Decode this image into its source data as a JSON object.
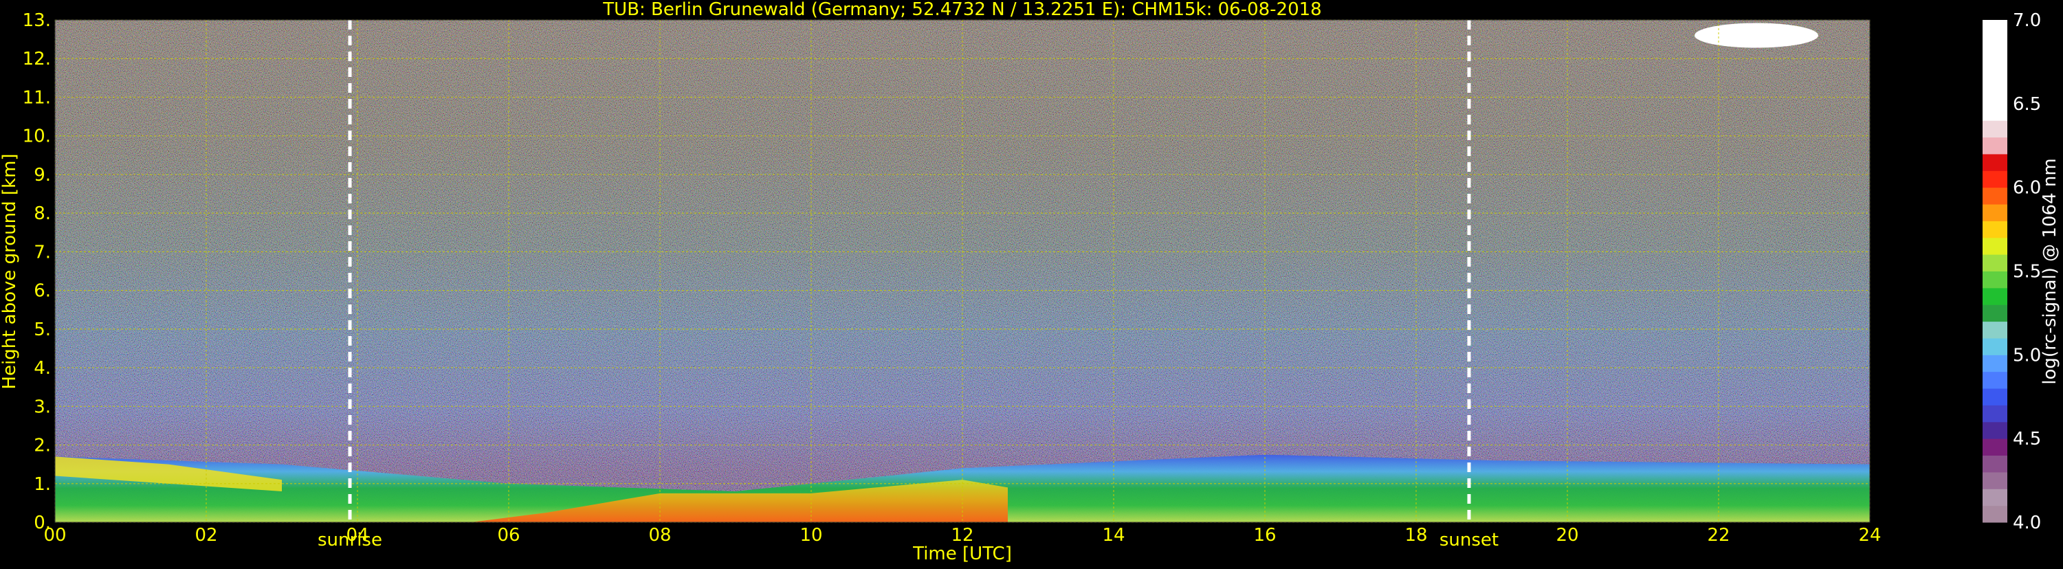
{
  "chart_data": {
    "type": "heatmap",
    "title": "TUB: Berlin Grunewald (Germany; 52.4732 N / 13.2251 E):    CHM15k: 06-08-2018",
    "xlabel": "Time [UTC]",
    "ylabel": "Height above ground [km]",
    "colorbar_label": "log(rc-signal) @ 1064 nm",
    "xlim": [
      0,
      24
    ],
    "ylim": [
      0,
      13
    ],
    "x_ticks": [
      "00",
      "02",
      "04",
      "06",
      "08",
      "10",
      "12",
      "14",
      "16",
      "18",
      "20",
      "22",
      "24"
    ],
    "x_tick_values": [
      0,
      2,
      4,
      6,
      8,
      10,
      12,
      14,
      16,
      18,
      20,
      22,
      24
    ],
    "y_ticks": [
      "0.",
      "1.",
      "2.",
      "3.",
      "4.",
      "5.",
      "6.",
      "7.",
      "8.",
      "9.",
      "10.",
      "11.",
      "12.",
      "13."
    ],
    "y_tick_values": [
      0,
      1,
      2,
      3,
      4,
      5,
      6,
      7,
      8,
      9,
      10,
      11,
      12,
      13
    ],
    "colorbar_ticks": [
      "4.0",
      "4.5",
      "5.0",
      "5.5",
      "6.0",
      "6.5",
      "7.0"
    ],
    "colorbar_tick_values": [
      4.0,
      4.5,
      5.0,
      5.5,
      6.0,
      6.5,
      7.0
    ],
    "colorbar_range": [
      4.0,
      7.0
    ],
    "events": [
      {
        "label": "sunrise",
        "time": 3.9
      },
      {
        "label": "sunset",
        "time": 18.7
      }
    ],
    "boundary_layer_top_km": [
      {
        "t": 0,
        "h": 1.7
      },
      {
        "t": 3,
        "h": 1.5
      },
      {
        "t": 6,
        "h": 1.0
      },
      {
        "t": 9,
        "h": 0.8
      },
      {
        "t": 12,
        "h": 1.4
      },
      {
        "t": 16,
        "h": 1.75
      },
      {
        "t": 19,
        "h": 1.6
      },
      {
        "t": 24,
        "h": 1.5
      }
    ],
    "grid": true,
    "colors": {
      "background": "#000000",
      "text": "#ffff00",
      "grid": "#cccc00",
      "event_line": "#ffffff",
      "colorbar_text": "#ffffff"
    }
  }
}
